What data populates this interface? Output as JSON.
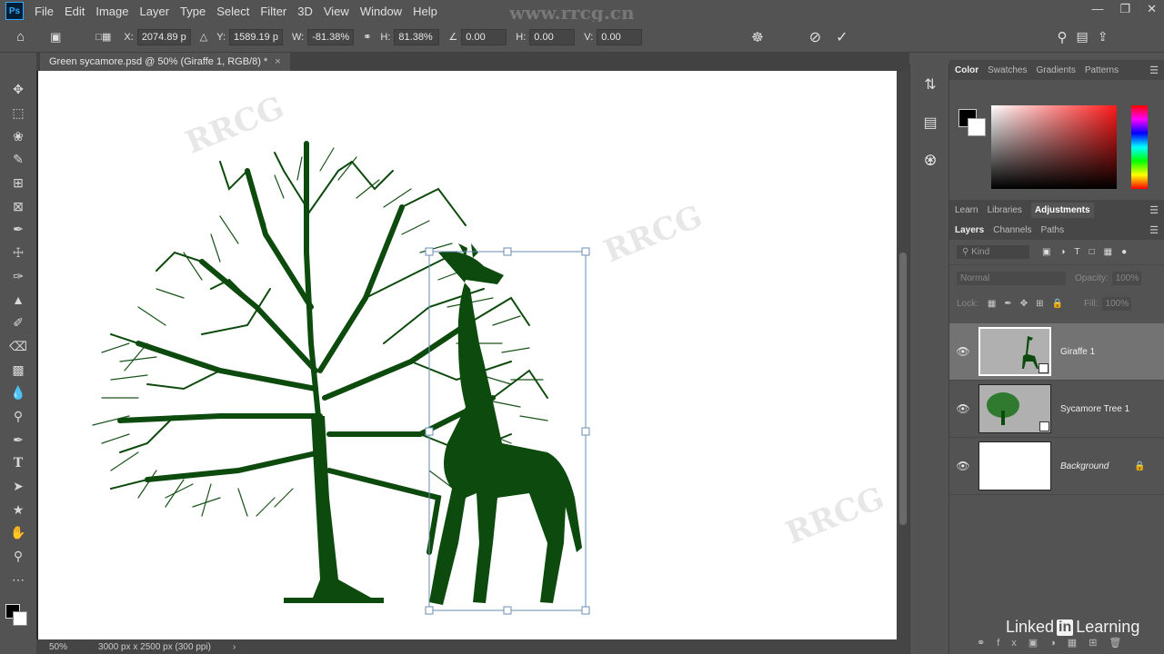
{
  "menubar": {
    "logo": "Ps",
    "items": [
      "File",
      "Edit",
      "Image",
      "Layer",
      "Type",
      "Select",
      "Filter",
      "3D",
      "View",
      "Window",
      "Help"
    ],
    "watermark_url": "www.rrcg.cn"
  },
  "options": {
    "x_label": "X:",
    "x_value": "2074.89 p",
    "y_label": "Y:",
    "y_value": "1589.19 p",
    "w_label": "W:",
    "w_value": "-81.38%",
    "h_label": "H:",
    "h_value": "81.38%",
    "angle_value": "0.00",
    "hskew_label": "H:",
    "hskew_value": "0.00",
    "vskew_label": "V:",
    "vskew_value": "0.00"
  },
  "document": {
    "tab_title": "Green sycamore.psd @ 50% (Giraffe 1, RGB/8) *",
    "tab_close": "×"
  },
  "status": {
    "zoom": "50%",
    "doc_info": "3000 px x 2500 px (300 ppi)"
  },
  "color_panel": {
    "tabs": [
      "Color",
      "Swatches",
      "Gradients",
      "Patterns"
    ],
    "fg": "#000000",
    "bg": "#ffffff"
  },
  "adjust_panel": {
    "tabs": [
      "Learn",
      "Libraries",
      "Adjustments"
    ]
  },
  "layers_panel": {
    "tabs": [
      "Layers",
      "Channels",
      "Paths"
    ],
    "kind_placeholder": "Kind",
    "blend_mode": "Normal",
    "opacity_label": "Opacity:",
    "opacity_value": "100%",
    "lock_label": "Lock:",
    "fill_label": "Fill:",
    "fill_value": "100%",
    "layers": [
      {
        "name": "Giraffe 1",
        "selected": true
      },
      {
        "name": "Sycamore Tree 1",
        "selected": false
      },
      {
        "name": "Background",
        "selected": false
      }
    ]
  },
  "branding": {
    "linkedin_a": "Linked",
    "linkedin_b": "in",
    "linkedin_c": "Learning"
  },
  "colors": {
    "silhouette": "#0d4a0d",
    "ui_bg": "#535353",
    "selection": "#6a8fb5"
  }
}
